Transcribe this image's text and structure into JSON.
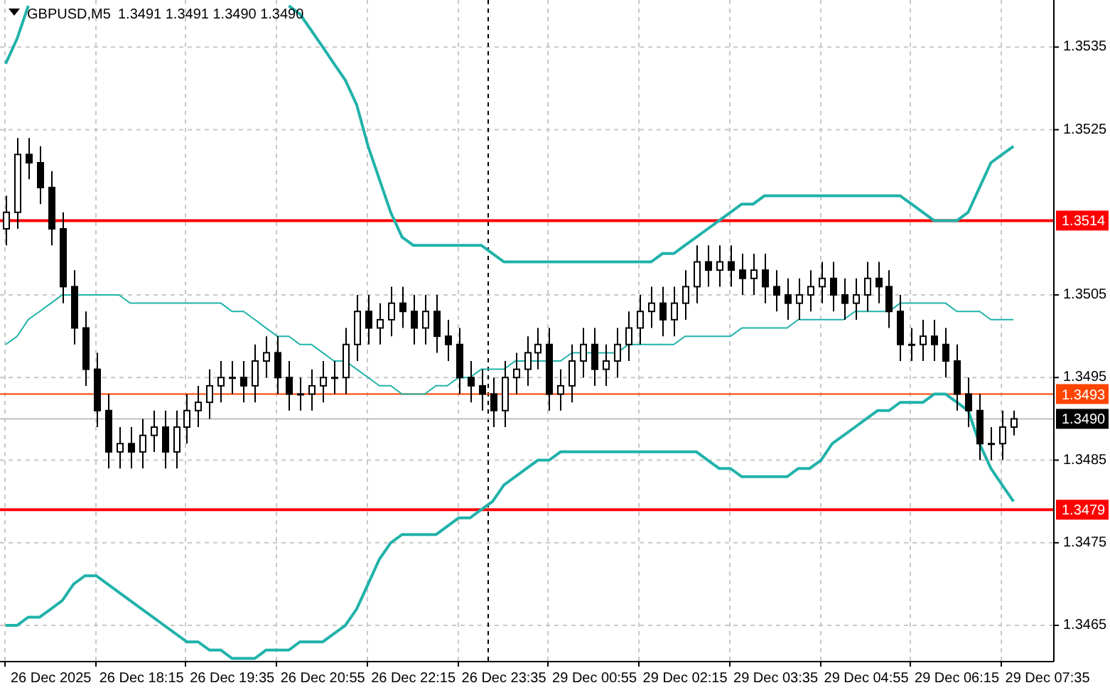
{
  "symbol": "GBPUSD,M5",
  "quote": "1.3491 1.3491 1.3490 1.3490",
  "chart_data": {
    "type": "candlestick",
    "grid": true,
    "ylim": [
      1.34607,
      1.35407
    ],
    "categories": [
      null,
      null,
      null,
      null,
      "26 Dec 2025",
      null,
      null,
      null,
      null,
      null,
      null,
      null,
      "26 Dec 18:15",
      null,
      null,
      null,
      null,
      null,
      null,
      null,
      "26 Dec 19:35",
      null,
      null,
      null,
      null,
      null,
      null,
      null,
      "26 Dec 20:55",
      null,
      null,
      null,
      null,
      null,
      null,
      null,
      "26 Dec 22:15",
      null,
      null,
      null,
      null,
      null,
      null,
      null,
      "26 Dec 23:35",
      null,
      null,
      null,
      null,
      null,
      null,
      null,
      "29 Dec 00:55",
      null,
      null,
      null,
      null,
      null,
      null,
      null,
      "29 Dec 02:15",
      null,
      null,
      null,
      null,
      null,
      null,
      null,
      "29 Dec 03:35",
      null,
      null,
      null,
      null,
      null,
      null,
      null,
      "29 Dec 04:55",
      null,
      null,
      null,
      null,
      null,
      null,
      null,
      "29 Dec 06:15",
      null,
      null,
      null,
      null,
      null,
      null,
      null,
      "29 Dec 07:35"
    ],
    "yticks": [
      1.3535,
      1.3525,
      1.3505,
      1.3495,
      1.3485,
      1.3475,
      1.3465
    ],
    "ohlc": [
      [
        1.3513,
        1.3517,
        1.3511,
        1.3515
      ],
      [
        1.3515,
        1.3524,
        1.3513,
        1.3522
      ],
      [
        1.3522,
        1.3524,
        1.3519,
        1.3521
      ],
      [
        1.3521,
        1.3523,
        1.3516,
        1.3518
      ],
      [
        1.3518,
        1.352,
        1.3511,
        1.3513
      ],
      [
        1.3513,
        1.3515,
        1.3504,
        1.3506
      ],
      [
        1.3506,
        1.3508,
        1.3499,
        1.3501
      ],
      [
        1.3501,
        1.3503,
        1.3494,
        1.3496
      ],
      [
        1.3496,
        1.3498,
        1.3489,
        1.3491
      ],
      [
        1.3491,
        1.3493,
        1.3484,
        1.3486
      ],
      [
        1.3486,
        1.3489,
        1.3484,
        1.3487
      ],
      [
        1.3487,
        1.3489,
        1.3484,
        1.3486
      ],
      [
        1.3486,
        1.349,
        1.3484,
        1.3488
      ],
      [
        1.3488,
        1.3491,
        1.3486,
        1.3489
      ],
      [
        1.3489,
        1.3491,
        1.3484,
        1.3486
      ],
      [
        1.3486,
        1.3491,
        1.3484,
        1.3489
      ],
      [
        1.3489,
        1.3493,
        1.3487,
        1.3491
      ],
      [
        1.3491,
        1.3494,
        1.3489,
        1.3492
      ],
      [
        1.3492,
        1.3496,
        1.349,
        1.3494
      ],
      [
        1.3494,
        1.3497,
        1.3492,
        1.3495
      ],
      [
        1.3495,
        1.3497,
        1.3493,
        1.3495
      ],
      [
        1.3495,
        1.3497,
        1.3492,
        1.3494
      ],
      [
        1.3494,
        1.3499,
        1.3492,
        1.3497
      ],
      [
        1.3497,
        1.35,
        1.3495,
        1.3498
      ],
      [
        1.3498,
        1.35,
        1.3493,
        1.3495
      ],
      [
        1.3495,
        1.3497,
        1.3491,
        1.3493
      ],
      [
        1.3493,
        1.3495,
        1.3491,
        1.3493
      ],
      [
        1.3493,
        1.3496,
        1.3491,
        1.3494
      ],
      [
        1.3494,
        1.3497,
        1.3492,
        1.3495
      ],
      [
        1.3495,
        1.3497,
        1.3493,
        1.3495
      ],
      [
        1.3495,
        1.3501,
        1.3493,
        1.3499
      ],
      [
        1.3499,
        1.3505,
        1.3497,
        1.3503
      ],
      [
        1.3503,
        1.3505,
        1.3499,
        1.3501
      ],
      [
        1.3501,
        1.3504,
        1.3499,
        1.3502
      ],
      [
        1.3502,
        1.3506,
        1.35,
        1.3504
      ],
      [
        1.3504,
        1.3506,
        1.3501,
        1.3503
      ],
      [
        1.3503,
        1.3505,
        1.3499,
        1.3501
      ],
      [
        1.3501,
        1.3505,
        1.3499,
        1.3503
      ],
      [
        1.3503,
        1.3505,
        1.3498,
        1.35
      ],
      [
        1.35,
        1.3502,
        1.3497,
        1.3499
      ],
      [
        1.3499,
        1.3501,
        1.3493,
        1.3495
      ],
      [
        1.3495,
        1.3497,
        1.3492,
        1.3494
      ],
      [
        1.3494,
        1.3496,
        1.3491,
        1.3493
      ],
      [
        1.3493,
        1.3495,
        1.3489,
        1.3491
      ],
      [
        1.3491,
        1.3497,
        1.3489,
        1.3495
      ],
      [
        1.3495,
        1.3498,
        1.3493,
        1.3496
      ],
      [
        1.3496,
        1.35,
        1.3494,
        1.3498
      ],
      [
        1.3498,
        1.3501,
        1.3496,
        1.3499
      ],
      [
        1.3499,
        1.3501,
        1.3491,
        1.3493
      ],
      [
        1.3493,
        1.3496,
        1.3491,
        1.3494
      ],
      [
        1.3494,
        1.3499,
        1.3492,
        1.3497
      ],
      [
        1.3497,
        1.3501,
        1.3495,
        1.3499
      ],
      [
        1.3499,
        1.3501,
        1.3494,
        1.3496
      ],
      [
        1.3496,
        1.3499,
        1.3494,
        1.3497
      ],
      [
        1.3497,
        1.3501,
        1.3495,
        1.3499
      ],
      [
        1.3499,
        1.3503,
        1.3497,
        1.3501
      ],
      [
        1.3501,
        1.3505,
        1.3499,
        1.3503
      ],
      [
        1.3503,
        1.3506,
        1.3501,
        1.3504
      ],
      [
        1.3504,
        1.3506,
        1.35,
        1.3502
      ],
      [
        1.3502,
        1.3506,
        1.35,
        1.3504
      ],
      [
        1.3504,
        1.3508,
        1.3502,
        1.3506
      ],
      [
        1.3506,
        1.3511,
        1.3504,
        1.3509
      ],
      [
        1.3509,
        1.3511,
        1.3506,
        1.3508
      ],
      [
        1.3508,
        1.3511,
        1.3506,
        1.3509
      ],
      [
        1.3509,
        1.3511,
        1.3506,
        1.3508
      ],
      [
        1.3508,
        1.351,
        1.3505,
        1.3507
      ],
      [
        1.3507,
        1.351,
        1.3505,
        1.3508
      ],
      [
        1.3508,
        1.351,
        1.3504,
        1.3506
      ],
      [
        1.3506,
        1.3508,
        1.3503,
        1.3505
      ],
      [
        1.3505,
        1.3507,
        1.3502,
        1.3504
      ],
      [
        1.3504,
        1.3507,
        1.3502,
        1.3505
      ],
      [
        1.3505,
        1.3508,
        1.3503,
        1.3506
      ],
      [
        1.3506,
        1.3509,
        1.3504,
        1.3507
      ],
      [
        1.3507,
        1.3509,
        1.3503,
        1.3505
      ],
      [
        1.3505,
        1.3507,
        1.3502,
        1.3504
      ],
      [
        1.3504,
        1.3507,
        1.3502,
        1.3505
      ],
      [
        1.3505,
        1.3509,
        1.3503,
        1.3507
      ],
      [
        1.3507,
        1.3509,
        1.3504,
        1.3506
      ],
      [
        1.3506,
        1.3508,
        1.3501,
        1.3503
      ],
      [
        1.3503,
        1.3505,
        1.3497,
        1.3499
      ],
      [
        1.3499,
        1.3501,
        1.3497,
        1.3499
      ],
      [
        1.3499,
        1.3502,
        1.3497,
        1.35
      ],
      [
        1.35,
        1.3502,
        1.3497,
        1.3499
      ],
      [
        1.3499,
        1.3501,
        1.3495,
        1.3497
      ],
      [
        1.3497,
        1.3499,
        1.3491,
        1.3493
      ],
      [
        1.3493,
        1.3495,
        1.3489,
        1.3491
      ],
      [
        1.3491,
        1.3493,
        1.3485,
        1.3487
      ],
      [
        1.3487,
        1.3489,
        1.3485,
        1.3487
      ],
      [
        1.3487,
        1.3491,
        1.3485,
        1.3489
      ],
      [
        1.3489,
        1.3491,
        1.3488,
        1.349
      ],
      null,
      null,
      null
    ],
    "series": [
      {
        "type": "line",
        "color": "#20b2aa",
        "values": [
          1.3533,
          1.3536,
          1.354,
          null,
          null,
          null,
          null,
          null,
          null,
          null,
          null,
          null,
          null,
          null,
          null,
          null,
          null,
          null,
          null,
          null,
          null,
          null,
          null,
          null,
          null,
          1.354,
          1.3539,
          1.3537,
          1.3535,
          1.3533,
          1.3531,
          1.3528,
          1.3523,
          1.3519,
          1.3515,
          1.3512,
          1.3511,
          1.3511,
          1.3511,
          1.3511,
          1.3511,
          1.3511,
          1.3511,
          1.351,
          1.3509,
          1.3509,
          1.3509,
          1.3509,
          1.3509,
          1.3509,
          1.3509,
          1.3509,
          1.3509,
          1.3509,
          1.3509,
          1.3509,
          1.3509,
          1.3509,
          1.351,
          1.351,
          1.3511,
          1.3512,
          1.3513,
          1.3514,
          1.3515,
          1.3516,
          1.3516,
          1.3517,
          1.3517,
          1.3517,
          1.3517,
          1.3517,
          1.3517,
          1.3517,
          1.3517,
          1.3517,
          1.3517,
          1.3517,
          1.3517,
          1.3517,
          1.3516,
          1.3515,
          1.3514,
          1.3514,
          1.3514,
          1.3515,
          1.3518,
          1.3521,
          1.3522,
          1.3523,
          null,
          null,
          null
        ]
      },
      {
        "type": "line",
        "color": "#20b2aa",
        "values": [
          1.3499,
          1.35,
          1.3502,
          1.3503,
          1.3504,
          1.3505,
          1.3505,
          1.3505,
          1.3505,
          1.3505,
          1.3505,
          1.3504,
          1.3504,
          1.3504,
          1.3504,
          1.3504,
          1.3504,
          1.3504,
          1.3504,
          1.3504,
          1.3503,
          1.3503,
          1.3502,
          1.3501,
          1.35,
          1.35,
          1.3499,
          1.3499,
          1.3498,
          1.3497,
          1.3497,
          1.3496,
          1.3495,
          1.3494,
          1.3494,
          1.3493,
          1.3493,
          1.3493,
          1.3494,
          1.3494,
          1.3495,
          1.3495,
          1.3496,
          1.3496,
          1.3496,
          1.3497,
          1.3497,
          1.3497,
          1.3497,
          1.3497,
          1.3498,
          1.3498,
          1.3498,
          1.3498,
          1.3498,
          1.3499,
          1.3499,
          1.3499,
          1.3499,
          1.3499,
          1.35,
          1.35,
          1.35,
          1.35,
          1.35,
          1.3501,
          1.3501,
          1.3501,
          1.3501,
          1.3501,
          1.3502,
          1.3502,
          1.3502,
          1.3502,
          1.3502,
          1.3503,
          1.3503,
          1.3503,
          1.3503,
          1.3504,
          1.3504,
          1.3504,
          1.3504,
          1.3504,
          1.3503,
          1.3503,
          1.3503,
          1.3502,
          1.3502,
          1.3502,
          null,
          null,
          null
        ]
      },
      {
        "type": "line",
        "color": "#20b2aa",
        "values": [
          1.3465,
          1.3465,
          1.3466,
          1.3466,
          1.3467,
          1.3468,
          1.347,
          1.3471,
          1.3471,
          1.347,
          1.3469,
          1.3468,
          1.3467,
          1.3466,
          1.3465,
          1.3464,
          1.3463,
          1.3463,
          1.3462,
          1.3462,
          1.3461,
          1.3461,
          1.3461,
          1.3462,
          1.3462,
          1.3462,
          1.3463,
          1.3463,
          1.3463,
          1.3464,
          1.3465,
          1.3467,
          1.347,
          1.3473,
          1.3475,
          1.3476,
          1.3476,
          1.3476,
          1.3476,
          1.3477,
          1.3478,
          1.3478,
          1.3479,
          1.348,
          1.3482,
          1.3483,
          1.3484,
          1.3485,
          1.3485,
          1.3486,
          1.3486,
          1.3486,
          1.3486,
          1.3486,
          1.3486,
          1.3486,
          1.3486,
          1.3486,
          1.3486,
          1.3486,
          1.3486,
          1.3486,
          1.3485,
          1.3484,
          1.3484,
          1.3483,
          1.3483,
          1.3483,
          1.3483,
          1.3483,
          1.3484,
          1.3484,
          1.3485,
          1.3487,
          1.3488,
          1.3489,
          1.349,
          1.3491,
          1.3491,
          1.3492,
          1.3492,
          1.3492,
          1.3493,
          1.3493,
          1.3492,
          1.3491,
          1.3487,
          1.3484,
          1.3482,
          1.348,
          null,
          null,
          null
        ]
      }
    ],
    "ref_lines": [
      {
        "axis": "y",
        "value": 1.3514,
        "label": "1.3514",
        "color": "#ff0000"
      },
      {
        "axis": "y",
        "value": 1.3493,
        "label": "1.3493",
        "color": "#ff4500"
      },
      {
        "axis": "y",
        "value": 1.3479,
        "label": "1.3479",
        "color": "#ff0000"
      },
      {
        "axis": "y",
        "value": 1.349,
        "label": "1.3490",
        "color": "#c0c0c0"
      }
    ]
  }
}
